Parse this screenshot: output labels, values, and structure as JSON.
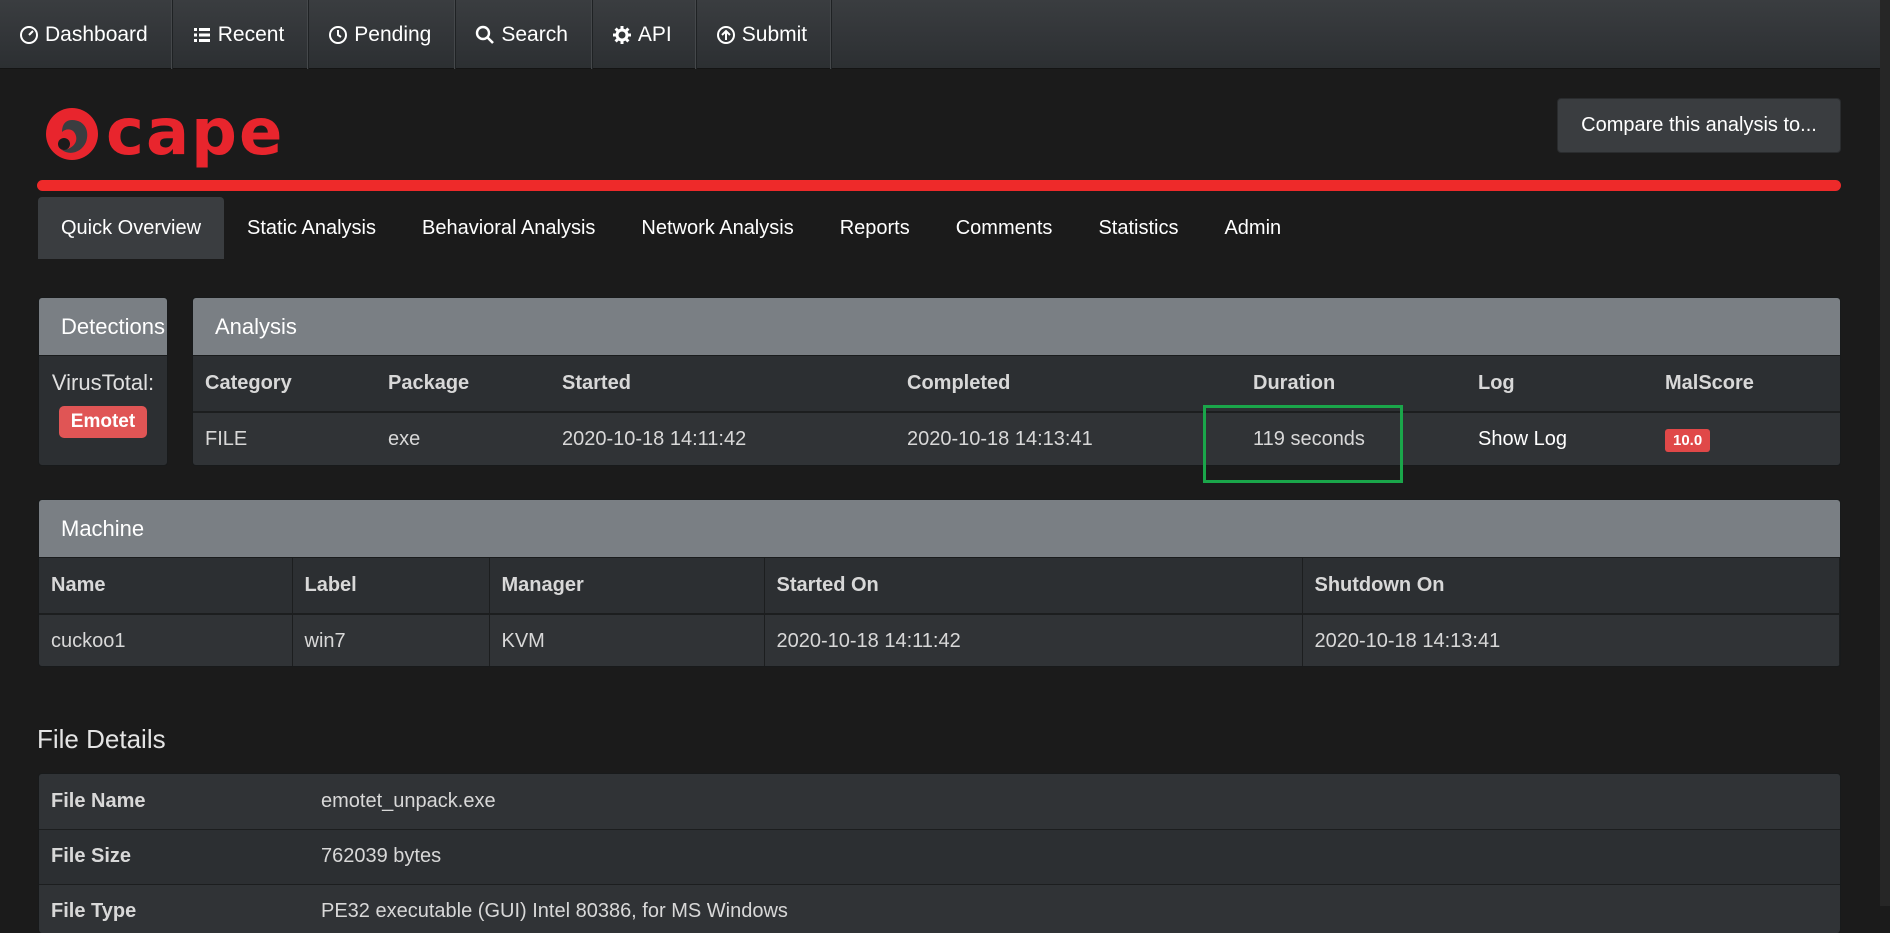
{
  "topnav": {
    "items": [
      {
        "label": "Dashboard",
        "icon": "dashboard-icon"
      },
      {
        "label": "Recent",
        "icon": "list-icon"
      },
      {
        "label": "Pending",
        "icon": "clock-icon"
      },
      {
        "label": "Search",
        "icon": "search-icon"
      },
      {
        "label": "API",
        "icon": "gear-icon"
      },
      {
        "label": "Submit",
        "icon": "upload-icon"
      }
    ]
  },
  "header": {
    "logo_text": "cape",
    "compare_label": "Compare this analysis to..."
  },
  "subtabs": [
    {
      "label": "Quick Overview",
      "active": true
    },
    {
      "label": "Static Analysis"
    },
    {
      "label": "Behavioral Analysis"
    },
    {
      "label": "Network Analysis"
    },
    {
      "label": "Reports"
    },
    {
      "label": "Comments"
    },
    {
      "label": "Statistics"
    },
    {
      "label": "Admin"
    }
  ],
  "detections": {
    "title": "Detections",
    "virustotal_label": "VirusTotal:",
    "family": "Emotet"
  },
  "analysis": {
    "title": "Analysis",
    "headers": [
      "Category",
      "Package",
      "Started",
      "Completed",
      "Duration",
      "Log",
      "MalScore"
    ],
    "row": {
      "category": "FILE",
      "package": "exe",
      "started": "2020-10-18 14:11:42",
      "completed": "2020-10-18 14:13:41",
      "duration": "119 seconds",
      "log": "Show Log",
      "malscore": "10.0"
    }
  },
  "machine": {
    "title": "Machine",
    "headers": [
      "Name",
      "Label",
      "Manager",
      "Started On",
      "Shutdown On"
    ],
    "row": {
      "name": "cuckoo1",
      "label": "win7",
      "manager": "KVM",
      "started_on": "2020-10-18 14:11:42",
      "shutdown_on": "2020-10-18 14:13:41"
    }
  },
  "file_details": {
    "title": "File Details",
    "rows": [
      {
        "key": "File Name",
        "value": "emotet_unpack.exe"
      },
      {
        "key": "File Size",
        "value": "762039 bytes"
      },
      {
        "key": "File Type",
        "value": "PE32 executable (GUI) Intel 80386, for MS Windows"
      }
    ]
  },
  "colors": {
    "accent_red": "#ee2a2a",
    "highlight_green": "#1aa64a",
    "panel_head": "#7a7f84"
  }
}
